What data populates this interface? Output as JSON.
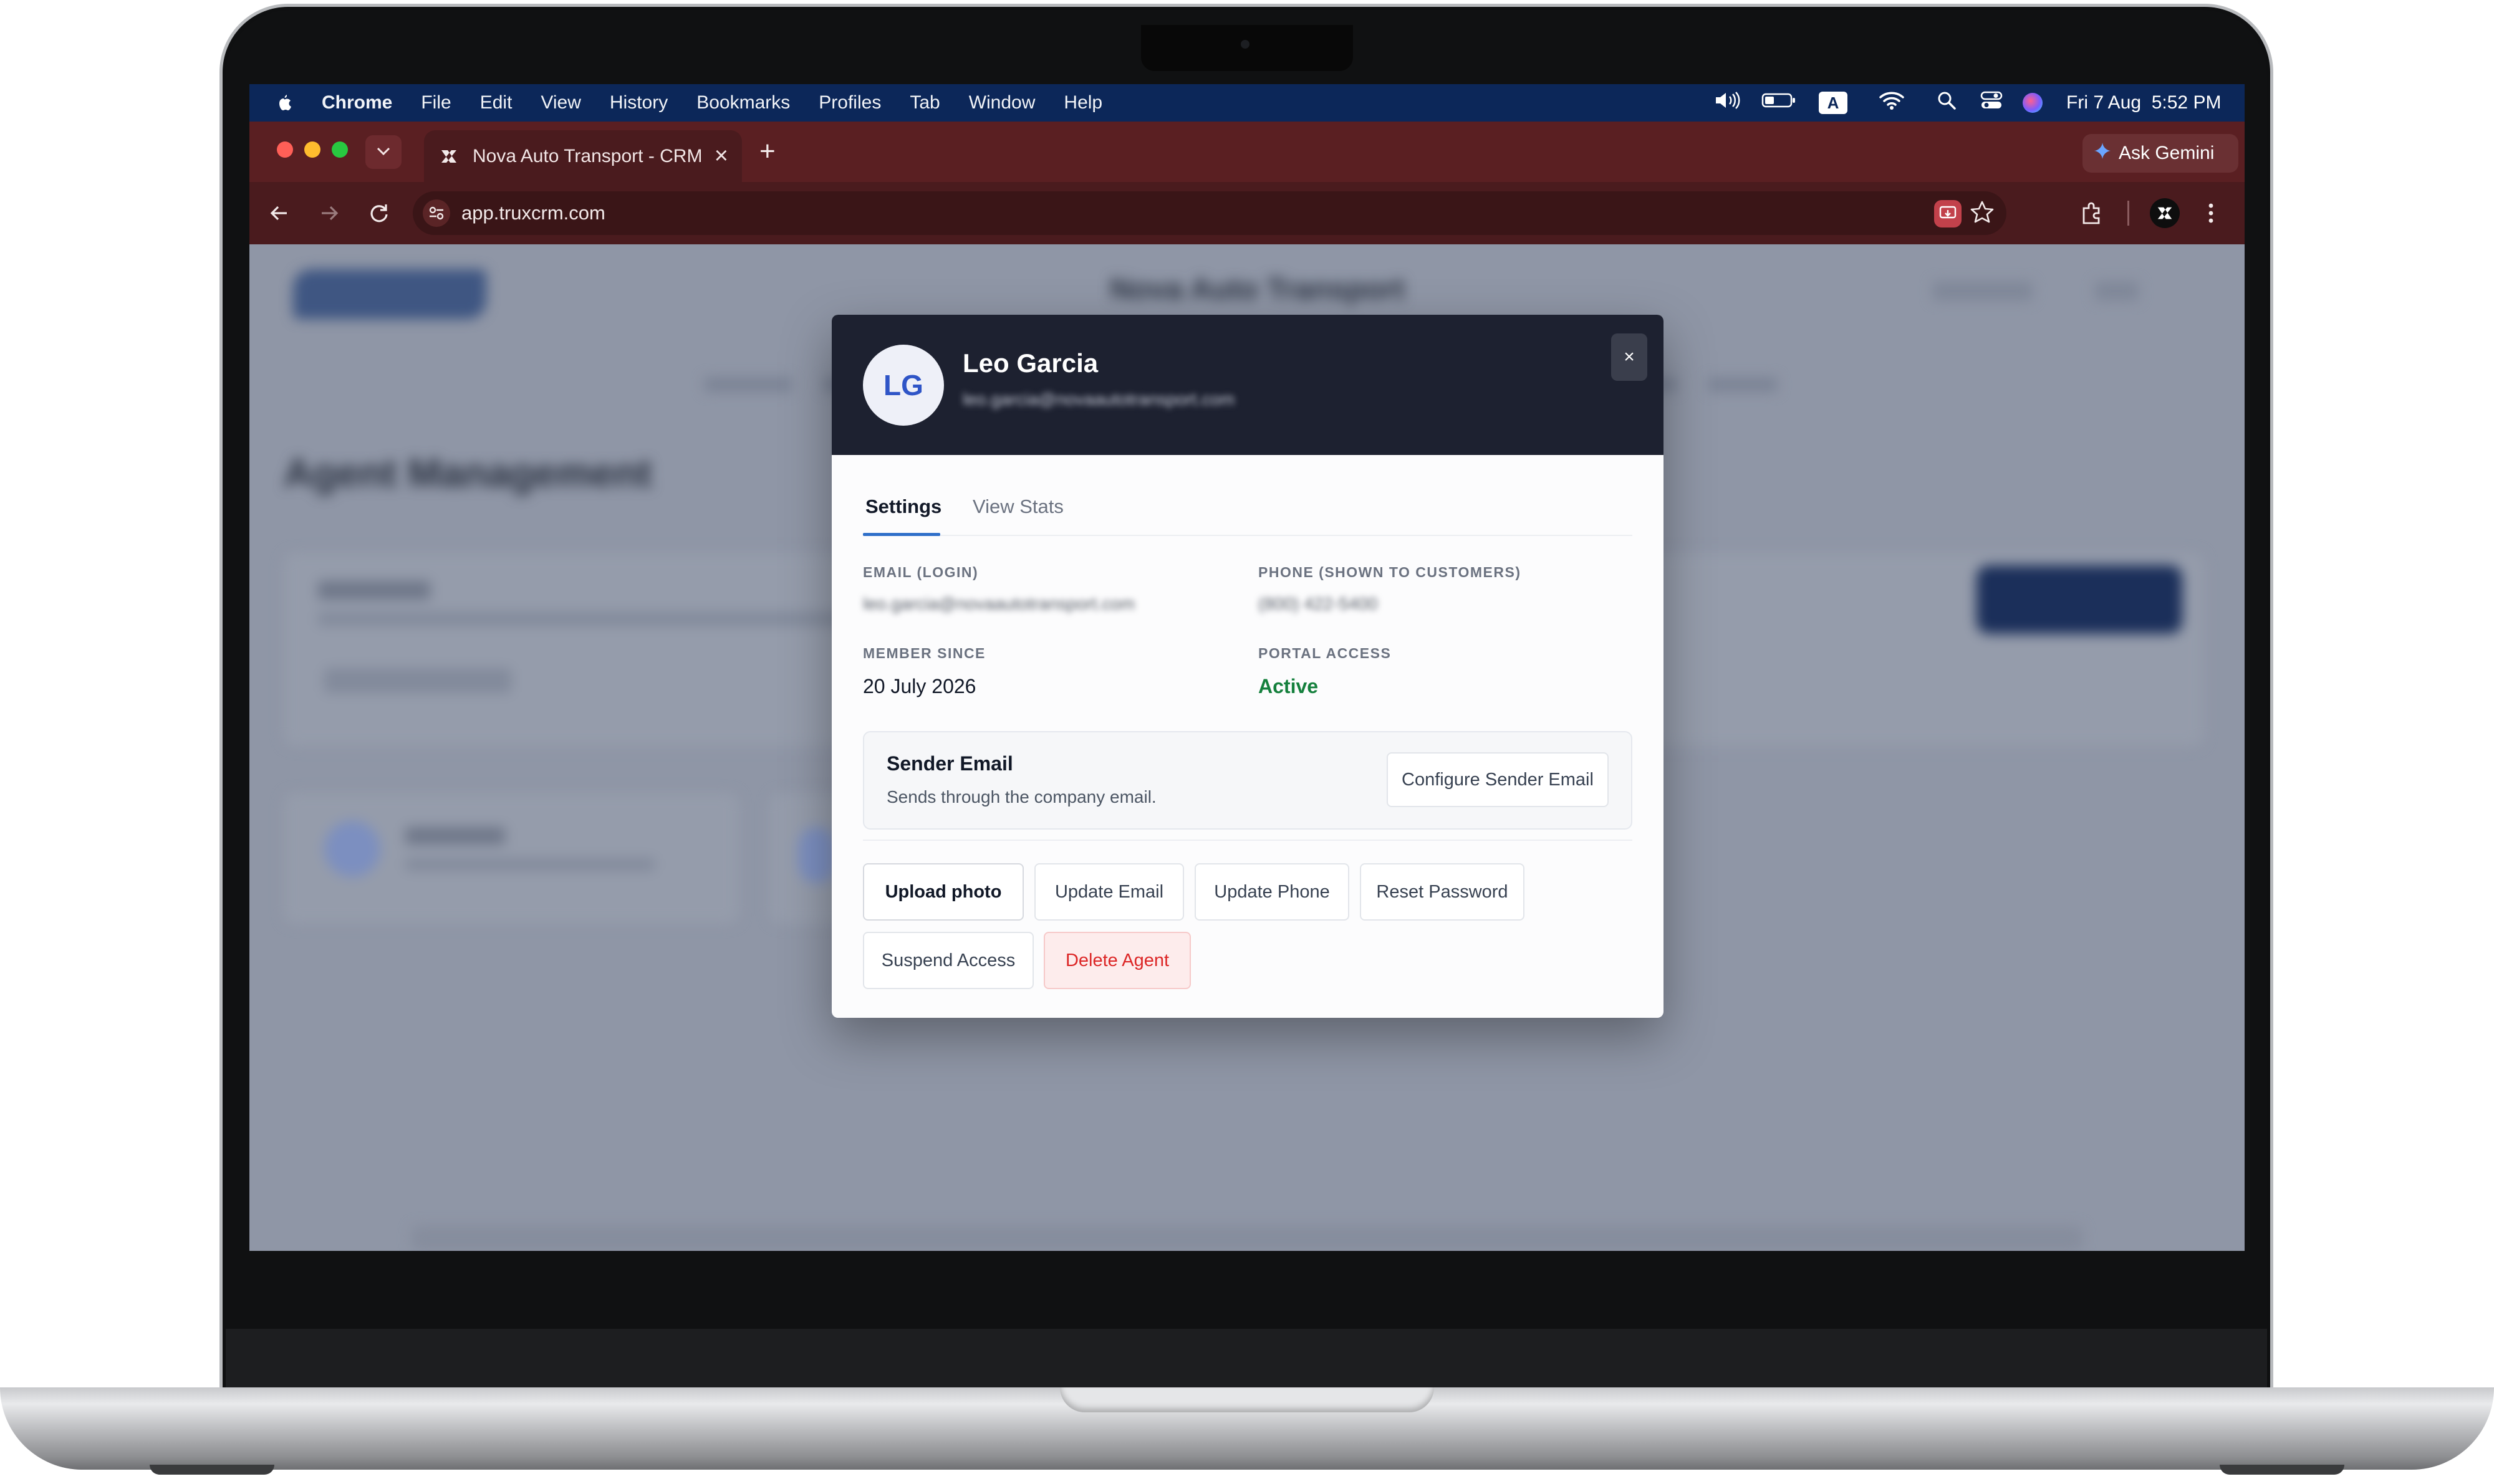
{
  "menubar": {
    "app": "Chrome",
    "items": [
      "File",
      "Edit",
      "View",
      "History",
      "Bookmarks",
      "Profiles",
      "Tab",
      "Window",
      "Help"
    ],
    "input_indicator": "A",
    "datetime": "Fri 7 Aug  5:52 PM"
  },
  "browser": {
    "tab_title": "Nova Auto Transport - CRM",
    "tab_close": "×",
    "new_tab": "+",
    "url": "app.truxcrm.com",
    "ask_gemini": "Ask Gemini",
    "colors": {
      "tabstrip": "#5a1f22",
      "toolbar": "#4a1b1e"
    }
  },
  "modal": {
    "avatar_initials": "LG",
    "name": "Leo Garcia",
    "email_blurred": "leo.garcia@novaautotransport.com",
    "close": "×",
    "tabs": [
      "Settings",
      "View Stats"
    ],
    "active_tab": "Settings",
    "fields": {
      "email_label": "EMAIL (LOGIN)",
      "email_value": "leo.garcia@novaautotransport.com",
      "phone_label": "PHONE (SHOWN TO CUSTOMERS)",
      "phone_value": "(800) 422-5400",
      "member_since_label": "MEMBER SINCE",
      "member_since_value": "20 July 2026",
      "portal_access_label": "PORTAL ACCESS",
      "portal_access_value": "Active"
    },
    "sender": {
      "title": "Sender Email",
      "subtitle": "Sends through the company email.",
      "button": "Configure Sender Email"
    },
    "actions": {
      "upload_photo": "Upload photo",
      "update_email": "Update Email",
      "update_phone": "Update Phone",
      "reset_password": "Reset Password",
      "suspend_access": "Suspend Access",
      "delete_agent": "Delete Agent"
    },
    "colors": {
      "header": "#1d2130",
      "accent": "#2f6fc9",
      "active": "#15803d",
      "danger": "#dc2626"
    }
  },
  "background_page": {
    "title": "Agent Management",
    "header_center": "Nova Auto Transport"
  }
}
